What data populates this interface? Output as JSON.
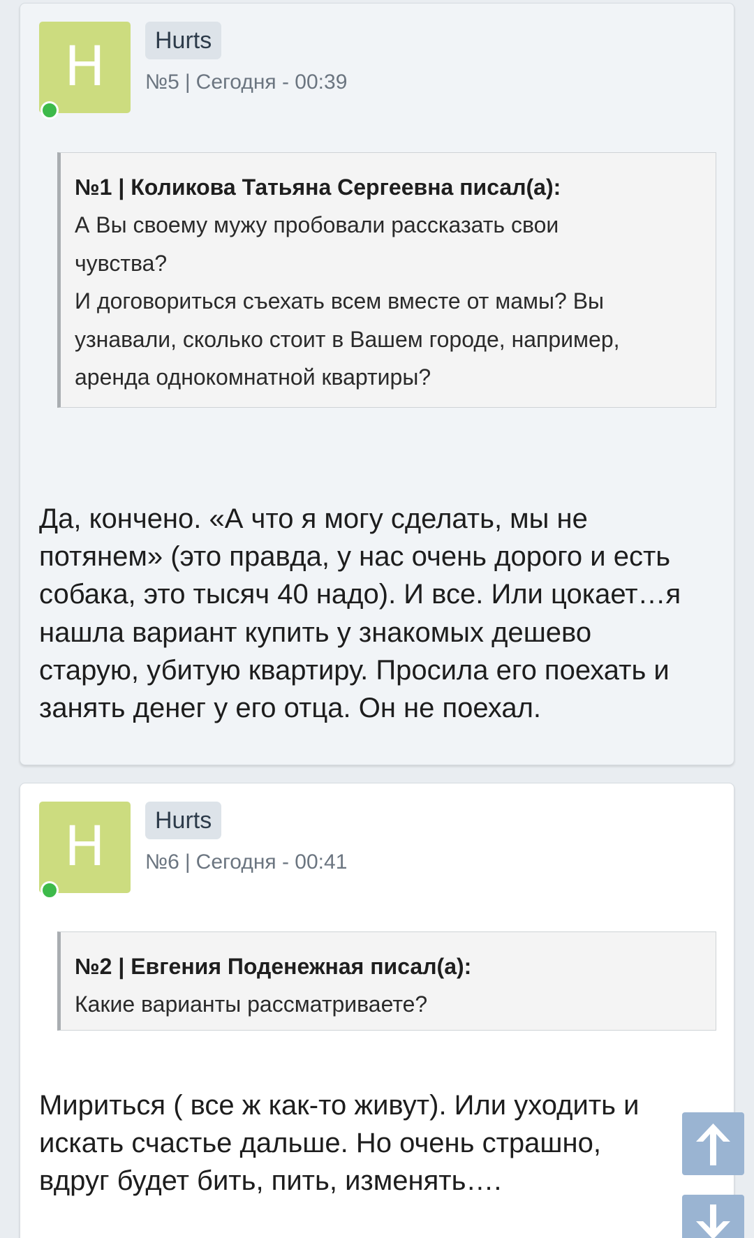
{
  "posts": [
    {
      "avatar_letter": "H",
      "author": "Hurts",
      "number": "№5",
      "separator": "|",
      "timestamp": "Сегодня - 00:39",
      "quote": {
        "header": "№1 | Коликова Татьяна Сергеевна писал(а):",
        "lines": [
          "А Вы своему мужу пробовали рассказать свои",
          "чувства?",
          "И договориться съехать всем вместе от мамы? Вы",
          "узнавали, сколько стоит в Вашем городе, например,",
          "аренда однокомнатной квартиры?"
        ]
      },
      "body": [
        "Да, кончено. «А что я могу сделать, мы не",
        "потянем» (это правда, у нас очень дорого и есть",
        "собака, это тысяч 40 надо). И все. Или цокает…я",
        "нашла вариант купить у знакомых дешево",
        "старую, убитую квартиру. Просила его поехать и",
        "занять денег у его отца. Он не поехал."
      ]
    },
    {
      "avatar_letter": "H",
      "author": "Hurts",
      "number": "№6",
      "separator": "|",
      "timestamp": "Сегодня - 00:41",
      "quote": {
        "header": "№2 | Евгения Поденежная писал(а):",
        "lines": [
          "Какие варианты рассматриваете?"
        ]
      },
      "body": [
        "Мириться ( все ж как-то живут). Или уходить и",
        "искать счастье дальше. Но очень страшно,",
        "вдруг будет бить, пить, изменять…."
      ]
    }
  ],
  "scroll_buttons": {
    "up_icon": "arrow-up-icon",
    "down_icon": "arrow-down-icon"
  },
  "colors": {
    "avatar": "#ccdc7f",
    "online": "#3dba4a",
    "scroll_button": "#9ab4d2"
  }
}
